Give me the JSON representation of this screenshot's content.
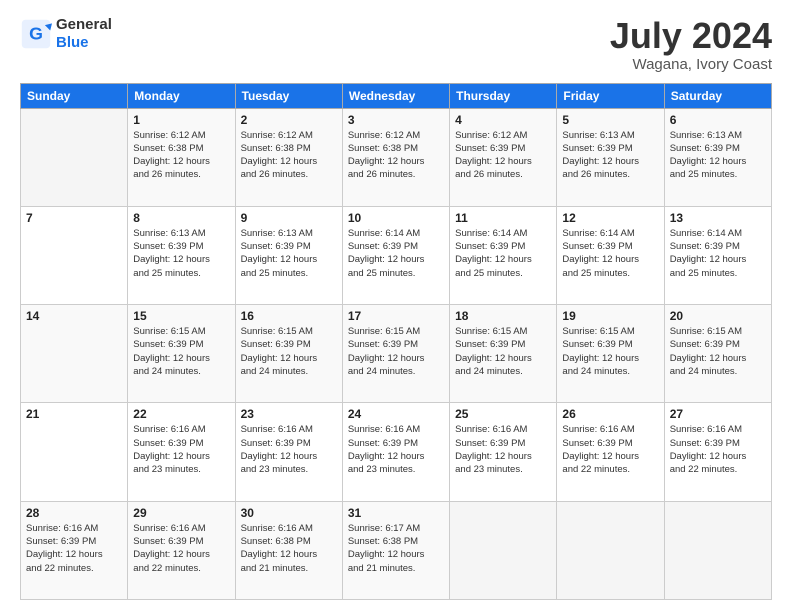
{
  "logo": {
    "line1": "General",
    "line2": "Blue"
  },
  "title": "July 2024",
  "location": "Wagana, Ivory Coast",
  "weekdays": [
    "Sunday",
    "Monday",
    "Tuesday",
    "Wednesday",
    "Thursday",
    "Friday",
    "Saturday"
  ],
  "weeks": [
    [
      {
        "day": "",
        "info": ""
      },
      {
        "day": "1",
        "info": "Sunrise: 6:12 AM\nSunset: 6:38 PM\nDaylight: 12 hours\nand 26 minutes."
      },
      {
        "day": "2",
        "info": "Sunrise: 6:12 AM\nSunset: 6:38 PM\nDaylight: 12 hours\nand 26 minutes."
      },
      {
        "day": "3",
        "info": "Sunrise: 6:12 AM\nSunset: 6:38 PM\nDaylight: 12 hours\nand 26 minutes."
      },
      {
        "day": "4",
        "info": "Sunrise: 6:12 AM\nSunset: 6:39 PM\nDaylight: 12 hours\nand 26 minutes."
      },
      {
        "day": "5",
        "info": "Sunrise: 6:13 AM\nSunset: 6:39 PM\nDaylight: 12 hours\nand 26 minutes."
      },
      {
        "day": "6",
        "info": "Sunrise: 6:13 AM\nSunset: 6:39 PM\nDaylight: 12 hours\nand 25 minutes."
      }
    ],
    [
      {
        "day": "7",
        "info": ""
      },
      {
        "day": "8",
        "info": "Sunrise: 6:13 AM\nSunset: 6:39 PM\nDaylight: 12 hours\nand 25 minutes."
      },
      {
        "day": "9",
        "info": "Sunrise: 6:13 AM\nSunset: 6:39 PM\nDaylight: 12 hours\nand 25 minutes."
      },
      {
        "day": "10",
        "info": "Sunrise: 6:14 AM\nSunset: 6:39 PM\nDaylight: 12 hours\nand 25 minutes."
      },
      {
        "day": "11",
        "info": "Sunrise: 6:14 AM\nSunset: 6:39 PM\nDaylight: 12 hours\nand 25 minutes."
      },
      {
        "day": "12",
        "info": "Sunrise: 6:14 AM\nSunset: 6:39 PM\nDaylight: 12 hours\nand 25 minutes."
      },
      {
        "day": "13",
        "info": "Sunrise: 6:14 AM\nSunset: 6:39 PM\nDaylight: 12 hours\nand 25 minutes."
      }
    ],
    [
      {
        "day": "14",
        "info": ""
      },
      {
        "day": "15",
        "info": "Sunrise: 6:15 AM\nSunset: 6:39 PM\nDaylight: 12 hours\nand 24 minutes."
      },
      {
        "day": "16",
        "info": "Sunrise: 6:15 AM\nSunset: 6:39 PM\nDaylight: 12 hours\nand 24 minutes."
      },
      {
        "day": "17",
        "info": "Sunrise: 6:15 AM\nSunset: 6:39 PM\nDaylight: 12 hours\nand 24 minutes."
      },
      {
        "day": "18",
        "info": "Sunrise: 6:15 AM\nSunset: 6:39 PM\nDaylight: 12 hours\nand 24 minutes."
      },
      {
        "day": "19",
        "info": "Sunrise: 6:15 AM\nSunset: 6:39 PM\nDaylight: 12 hours\nand 24 minutes."
      },
      {
        "day": "20",
        "info": "Sunrise: 6:15 AM\nSunset: 6:39 PM\nDaylight: 12 hours\nand 24 minutes."
      }
    ],
    [
      {
        "day": "21",
        "info": ""
      },
      {
        "day": "22",
        "info": "Sunrise: 6:16 AM\nSunset: 6:39 PM\nDaylight: 12 hours\nand 23 minutes."
      },
      {
        "day": "23",
        "info": "Sunrise: 6:16 AM\nSunset: 6:39 PM\nDaylight: 12 hours\nand 23 minutes."
      },
      {
        "day": "24",
        "info": "Sunrise: 6:16 AM\nSunset: 6:39 PM\nDaylight: 12 hours\nand 23 minutes."
      },
      {
        "day": "25",
        "info": "Sunrise: 6:16 AM\nSunset: 6:39 PM\nDaylight: 12 hours\nand 23 minutes."
      },
      {
        "day": "26",
        "info": "Sunrise: 6:16 AM\nSunset: 6:39 PM\nDaylight: 12 hours\nand 22 minutes."
      },
      {
        "day": "27",
        "info": "Sunrise: 6:16 AM\nSunset: 6:39 PM\nDaylight: 12 hours\nand 22 minutes."
      }
    ],
    [
      {
        "day": "28",
        "info": "Sunrise: 6:16 AM\nSunset: 6:39 PM\nDaylight: 12 hours\nand 22 minutes."
      },
      {
        "day": "29",
        "info": "Sunrise: 6:16 AM\nSunset: 6:39 PM\nDaylight: 12 hours\nand 22 minutes."
      },
      {
        "day": "30",
        "info": "Sunrise: 6:16 AM\nSunset: 6:38 PM\nDaylight: 12 hours\nand 21 minutes."
      },
      {
        "day": "31",
        "info": "Sunrise: 6:17 AM\nSunset: 6:38 PM\nDaylight: 12 hours\nand 21 minutes."
      },
      {
        "day": "",
        "info": ""
      },
      {
        "day": "",
        "info": ""
      },
      {
        "day": "",
        "info": ""
      }
    ]
  ]
}
